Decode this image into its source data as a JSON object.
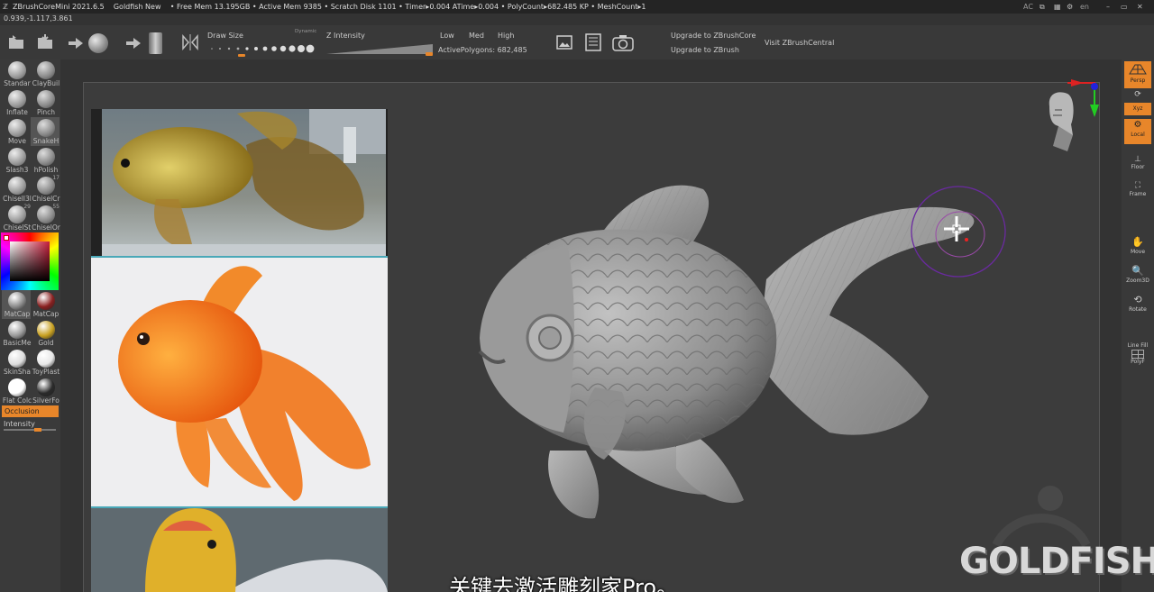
{
  "titlebar": {
    "app": "ZBrushCoreMini 2021.6.5",
    "doc": "Goldfish New",
    "stats": "• Free Mem 13.195GB • Active Mem 9385 • Scratch Disk 1101 • Timer▸0.004 ATime▸0.004 • PolyCount▸682.485 KP • MeshCount▸1",
    "ac": "AC",
    "lang": "en"
  },
  "coords": "0.939,-1.117,3.861",
  "toolbar": {
    "draw_size": "Draw Size",
    "dynamic": "Dynamic",
    "z_intensity": "Z Intensity",
    "low": "Low",
    "med": "Med",
    "high": "High",
    "active_polygons": "ActivePolygons: 682,485",
    "upgrade_core": "Upgrade to ZBrushCore",
    "upgrade_zbrush": "Upgrade to ZBrush",
    "visit": "Visit ZBrushCentral"
  },
  "brushes": [
    {
      "label": "Standar"
    },
    {
      "label": "ClayBuil"
    },
    {
      "label": "Inflate"
    },
    {
      "label": "Pinch"
    },
    {
      "label": "Move"
    },
    {
      "label": "SnakeH"
    },
    {
      "label": "Slash3"
    },
    {
      "label": "hPolish"
    },
    {
      "label": "ChiselI3l",
      "num": ""
    },
    {
      "label": "ChiselCr",
      "num": "17"
    },
    {
      "label": "ChiselSt",
      "num": "29"
    },
    {
      "label": "ChiselOr",
      "num": "55"
    }
  ],
  "materials": [
    {
      "label": "MatCap",
      "color": "#8a8a8a"
    },
    {
      "label": "MatCap",
      "color": "#8a2020"
    },
    {
      "label": "BasicMe",
      "color": "#9a9a9a"
    },
    {
      "label": "Gold",
      "color": "#c8a020"
    },
    {
      "label": "SkinSha",
      "color": "#dcdcdc"
    },
    {
      "label": "ToyPlast",
      "color": "#e8e8e8"
    },
    {
      "label": "Flat Colc",
      "color": "#ffffff"
    },
    {
      "label": "SilverFo",
      "color": "#2a2a2a"
    }
  ],
  "occlusion": "Occlusion",
  "intensity": "Intensity",
  "right_tools": {
    "persp": "Persp",
    "xyz": "Xyz",
    "local": "Local",
    "floor": "Floor",
    "frame": "Frame",
    "move": "Move",
    "zoom3d": "Zoom3D",
    "rotate": "Rotate",
    "line_fill": "Line Fill",
    "polyf": "PolyF"
  },
  "subtitle": "关键去激活雕刻家Pro。",
  "brand": "GOLDFISH",
  "colors": {
    "accent": "#e8862a",
    "bg": "#333333",
    "viewport": "#3c3c3c"
  }
}
